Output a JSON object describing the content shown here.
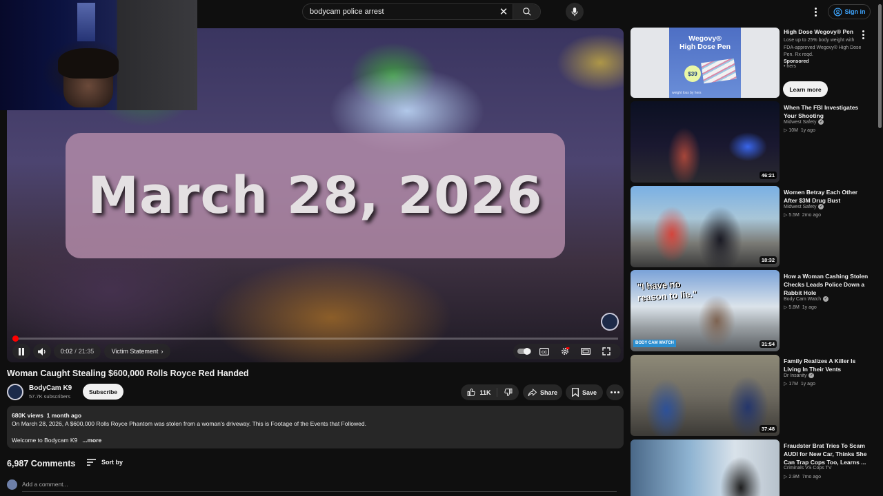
{
  "header": {
    "search_query": "bodycam police arrest",
    "sign_in_label": "Sign in"
  },
  "player": {
    "overlay_text": "March 28, 2026",
    "time_current": "0:02",
    "time_separator": "/",
    "time_total": "21:35",
    "chapter": "Victim Statement",
    "progress_fraction": 0.001
  },
  "video": {
    "title": "Woman Caught Stealing $600,000 Rolls Royce Red Handed",
    "channel_name": "BodyCam K9",
    "subscribers": "57.7K subscribers",
    "subscribe_label": "Subscribe",
    "likes": "11K",
    "share_label": "Share",
    "save_label": "Save"
  },
  "description": {
    "views": "680K views",
    "age": "1 month ago",
    "line1": "On March 28, 2026, A $600,000 Rolls Royce Phantom was stolen from a woman's driveway. This is Footage of the Events that Followed.",
    "line2": "Welcome to Bodycam K9",
    "more_label": "...more"
  },
  "comments": {
    "count": "6,987 Comments",
    "sort_label": "Sort by",
    "add_placeholder": "Add a comment..."
  },
  "ad": {
    "thumb_brand_line1": "Wegovy®",
    "thumb_brand_line2": "High Dose Pen",
    "thumb_price": "$39",
    "thumb_footer": "weight loss by hers",
    "title": "High Dose Wegovy® Pen",
    "body": "Lose up to 25% body weight with FDA-approved Wegovy® High Dose Pen. Rx reqd.",
    "sponsored": "Sponsored",
    "advertiser": "• hers",
    "cta": "Learn more"
  },
  "recommendations": [
    {
      "title": "When The FBI Investigates Your Shooting",
      "channel": "Midwest Safety",
      "verified": true,
      "views": "10M",
      "age": "1y ago",
      "duration": "46:21"
    },
    {
      "title": "Women Betray Each Other After $3M Drug Bust",
      "channel": "Midwest Safety",
      "verified": true,
      "views": "5.5M",
      "age": "2mo ago",
      "duration": "18:32"
    },
    {
      "title": "How a Woman Cashing Stolen Checks Leads Police Down a Rabbit Hole",
      "channel": "Body Cam Watch",
      "verified": true,
      "views": "5.8M",
      "age": "1y ago",
      "duration": "31:54",
      "thumb_caption_1": "\"I have no",
      "thumb_caption_2": "reason to lie.\"",
      "thumb_badge": "BODY CAM WATCH"
    },
    {
      "title": "Family Realizes A Killer Is Living In Their Vents",
      "channel": "Dr Insanity",
      "verified": true,
      "views": "17M",
      "age": "1y ago",
      "duration": "37:48"
    },
    {
      "title": "Fraudster Brat Tries To Scam AUDI for New Car, Thinks She Can Trap Cops Too,  Learns ...",
      "channel": "Criminals VS Cops TV",
      "verified": false,
      "views": "2.9M",
      "age": "7mo ago",
      "duration": ""
    }
  ]
}
